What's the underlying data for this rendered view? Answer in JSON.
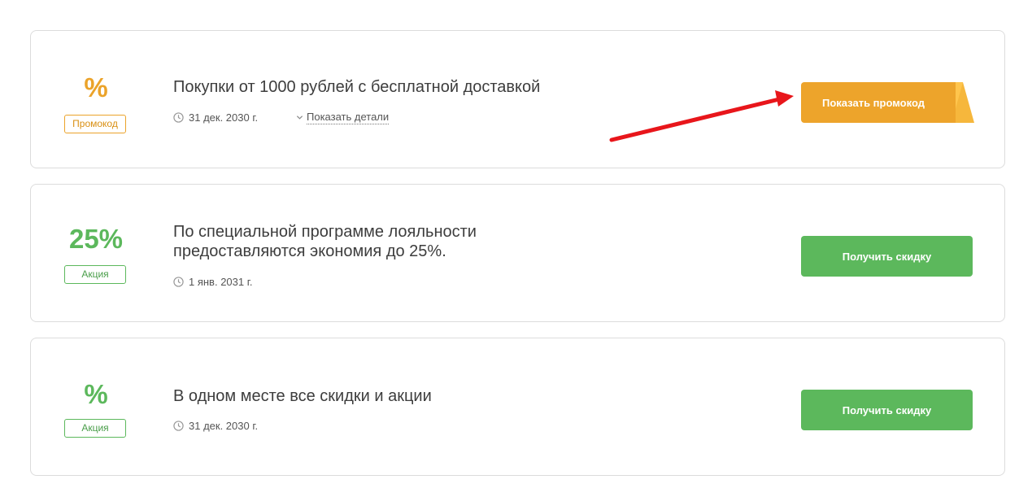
{
  "offers": [
    {
      "value": "%",
      "tag": "Промокод",
      "title": "Покупки от 1000 рублей с бесплатной доставкой",
      "date": "31 дек. 2030 г.",
      "details_label": "Показать детали",
      "button_label": "Показать промокод",
      "accent": "#eba32a"
    },
    {
      "value": "25%",
      "tag": "Акция",
      "title": "По специальной программе лояльности предоставляются экономия до 25%.",
      "date": "1 янв. 2031 г.",
      "button_label": "Получить скидку",
      "accent": "#5cb85c"
    },
    {
      "value": "%",
      "tag": "Акция",
      "title": "В одном месте все скидки и акции",
      "date": "31 дек. 2030 г.",
      "button_label": "Получить скидку",
      "accent": "#5cb85c"
    }
  ],
  "colors": {
    "promo_button": "#eda42b",
    "action_button": "#5cb85c",
    "annotation_arrow": "#e8161b"
  },
  "icons": [
    "clock-icon",
    "chevron-down-icon",
    "red-arrow"
  ]
}
